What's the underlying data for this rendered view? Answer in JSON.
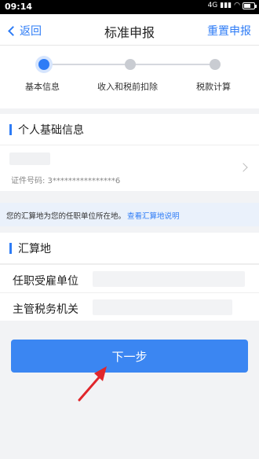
{
  "status": {
    "time": "09:14",
    "network": "4G",
    "battery_level": 0.7
  },
  "nav": {
    "back_label": "返回",
    "title": "标准申报",
    "reset_label": "重置申报"
  },
  "steps": [
    {
      "label": "基本信息",
      "active": true
    },
    {
      "label": "收入和税前扣除",
      "active": false
    },
    {
      "label": "税款计算",
      "active": false
    }
  ],
  "personal": {
    "section_title": "个人基础信息",
    "id_label": "证件号码: 3****************6"
  },
  "notice": {
    "text": "您的汇算地为您的任职单位所在地。",
    "link": "查看汇算地说明"
  },
  "settlement": {
    "section_title": "汇算地",
    "fields": [
      {
        "label": "任职受雇单位"
      },
      {
        "label": "主管税务机关"
      }
    ]
  },
  "next_button": "下一步",
  "colors": {
    "accent": "#2e7cf6",
    "button": "#3b86f2",
    "annotation_arrow": "#e0262b"
  }
}
